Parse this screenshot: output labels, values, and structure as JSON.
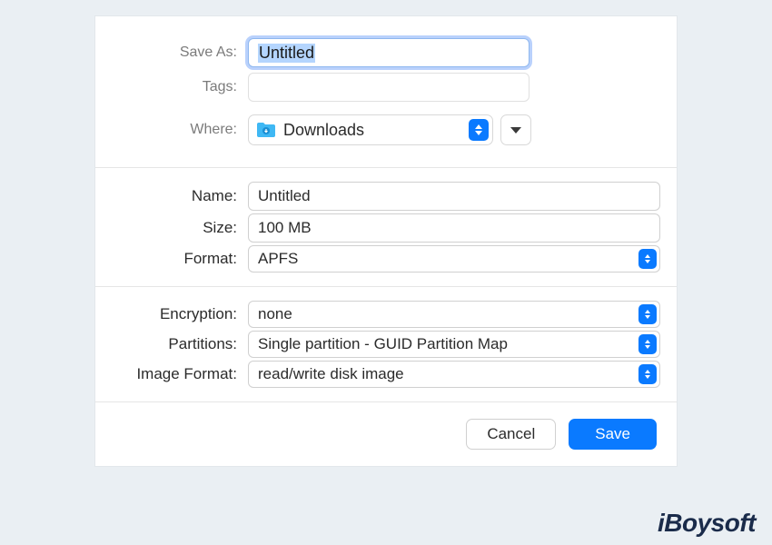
{
  "saveAs": {
    "label": "Save As:",
    "value": "Untitled"
  },
  "tags": {
    "label": "Tags:",
    "value": ""
  },
  "where": {
    "label": "Where:",
    "value": "Downloads",
    "icon": "folder-downloads-icon"
  },
  "name": {
    "label": "Name:",
    "value": "Untitled"
  },
  "size": {
    "label": "Size:",
    "value": "100 MB"
  },
  "format": {
    "label": "Format:",
    "value": "APFS"
  },
  "encryption": {
    "label": "Encryption:",
    "value": "none"
  },
  "partitions": {
    "label": "Partitions:",
    "value": "Single partition - GUID Partition Map"
  },
  "imageFormat": {
    "label": "Image Format:",
    "value": "read/write disk image"
  },
  "buttons": {
    "cancel": "Cancel",
    "save": "Save"
  },
  "watermark": "iBoysoft"
}
